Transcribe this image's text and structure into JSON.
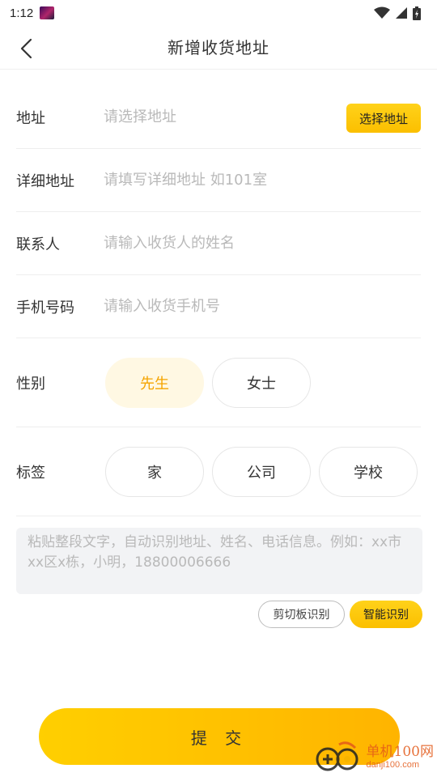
{
  "status_bar": {
    "time": "1:12"
  },
  "header": {
    "title": "新增收货地址"
  },
  "form": {
    "address": {
      "label": "地址",
      "placeholder": "请选择地址",
      "select_button": "选择地址"
    },
    "detail": {
      "label": "详细地址",
      "placeholder": "请填写详细地址 如101室"
    },
    "contact": {
      "label": "联系人",
      "placeholder": "请输入收货人的姓名"
    },
    "phone": {
      "label": "手机号码",
      "placeholder": "请输入收货手机号"
    },
    "gender": {
      "label": "性别",
      "options": [
        "先生",
        "女士"
      ],
      "selected": "先生"
    },
    "tag": {
      "label": "标签",
      "options": [
        "家",
        "公司",
        "学校"
      ]
    }
  },
  "paste": {
    "placeholder": "粘贴整段文字，自动识别地址、姓名、电话信息。例如：xx市xx区x栋，小明，18800006666",
    "clipboard_button": "剪切板识别",
    "smart_button": "智能识别"
  },
  "submit_label": "提 交",
  "watermark": {
    "name": "单机100网",
    "url": "danji100.com"
  },
  "colors": {
    "accent": "#fbbf00",
    "selected_text": "#f5a400",
    "selected_bg": "#fff8e3"
  }
}
